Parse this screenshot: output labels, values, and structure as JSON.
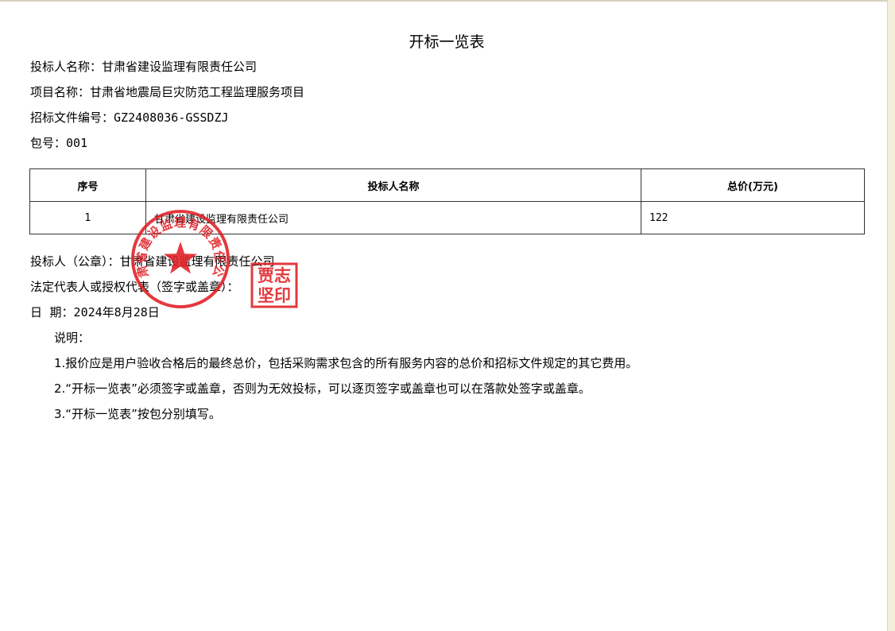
{
  "document": {
    "title": "开标一览表",
    "bidder_line": "投标人名称：甘肃省建设监理有限责任公司",
    "project_line": "项目名称：甘肃省地震局巨灾防范工程监理服务项目",
    "tender_no_label": "招标文件编号：",
    "tender_no": "GZ2408036-GSSDZJ",
    "package_label": "包号：",
    "package_no": "001"
  },
  "table": {
    "headers": [
      "序号",
      "投标人名称",
      "总价(万元)"
    ],
    "rows": [
      {
        "no": "1",
        "name": "甘肃省建设监理有限责任公司",
        "price": "122"
      }
    ]
  },
  "signature": {
    "stamp_line": "投标人（公章）：甘肃省建设监理有限责任公司",
    "rep_line": "法定代表人或授权代表（签字或盖章）：",
    "date_label": "日  期：",
    "date_value": "2024年8月28日"
  },
  "notes": {
    "heading": "说明：",
    "items": [
      "1.报价应是用户验收合格后的最终总价，包括采购需求包含的所有服务内容的总价和招标文件规定的其它费用。",
      "2.“开标一览表”必须签字或盖章，否则为无效投标，可以逐页签字或盖章也可以在落款处签字或盖章。",
      "3.“开标一览表”按包分别填写。"
    ]
  },
  "seals": {
    "round_seal_text": "甘肃省建设监理有限责任公司",
    "square_seal_text": "贾志坚印",
    "seal_color": "#e0242a"
  }
}
